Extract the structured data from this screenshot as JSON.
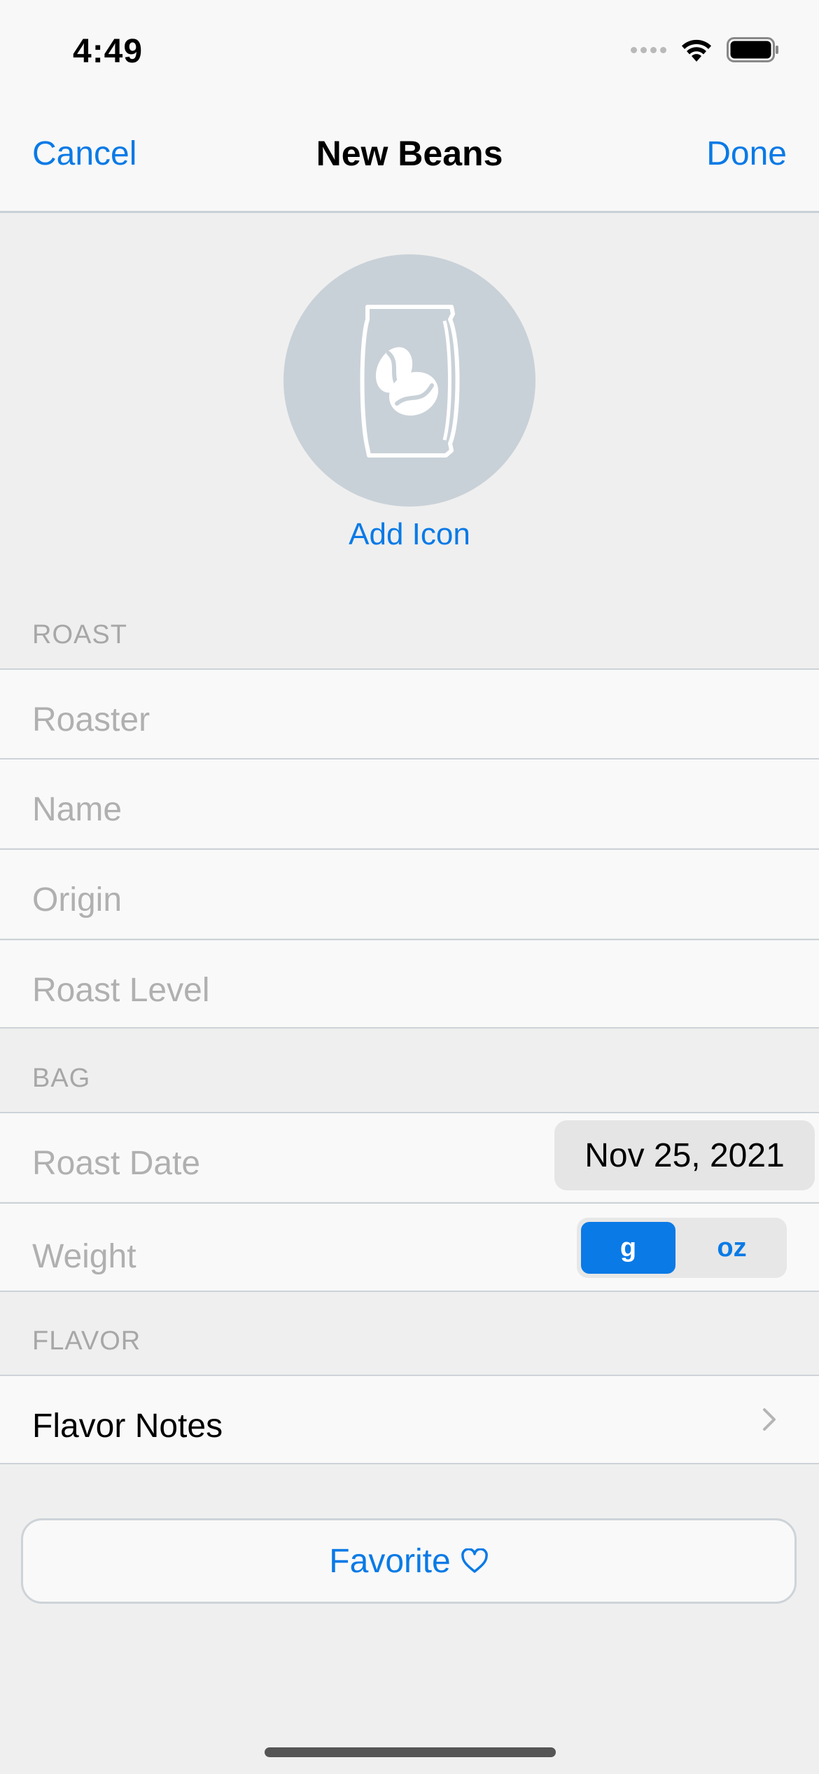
{
  "status_bar": {
    "time": "4:49",
    "icons": [
      "cellular-icon",
      "wifi-icon",
      "battery-icon"
    ]
  },
  "nav": {
    "cancel_label": "Cancel",
    "title": "New Beans",
    "done_label": "Done"
  },
  "icon_picker": {
    "icon": "coffee-bag-icon",
    "add_label": "Add Icon"
  },
  "sections": {
    "roast": {
      "header": "ROAST",
      "fields": [
        {
          "placeholder": "Roaster",
          "value": ""
        },
        {
          "placeholder": "Name",
          "value": ""
        },
        {
          "placeholder": "Origin",
          "value": ""
        },
        {
          "placeholder": "Roast Level",
          "value": ""
        }
      ]
    },
    "bag": {
      "header": "BAG",
      "roast_date_label": "Roast Date",
      "roast_date_value": "Nov 25, 2021",
      "weight_label": "Weight",
      "weight_units": [
        "g",
        "oz"
      ],
      "weight_unit_selected": "g"
    },
    "flavor": {
      "header": "FLAVOR",
      "flavor_notes_label": "Flavor Notes"
    }
  },
  "favorite": {
    "label": "Favorite",
    "icon": "heart-icon"
  },
  "colors": {
    "accent": "#0a7ae6",
    "background": "#efefef",
    "row_background": "#f9f9f9",
    "placeholder": "#b0b0b0"
  }
}
